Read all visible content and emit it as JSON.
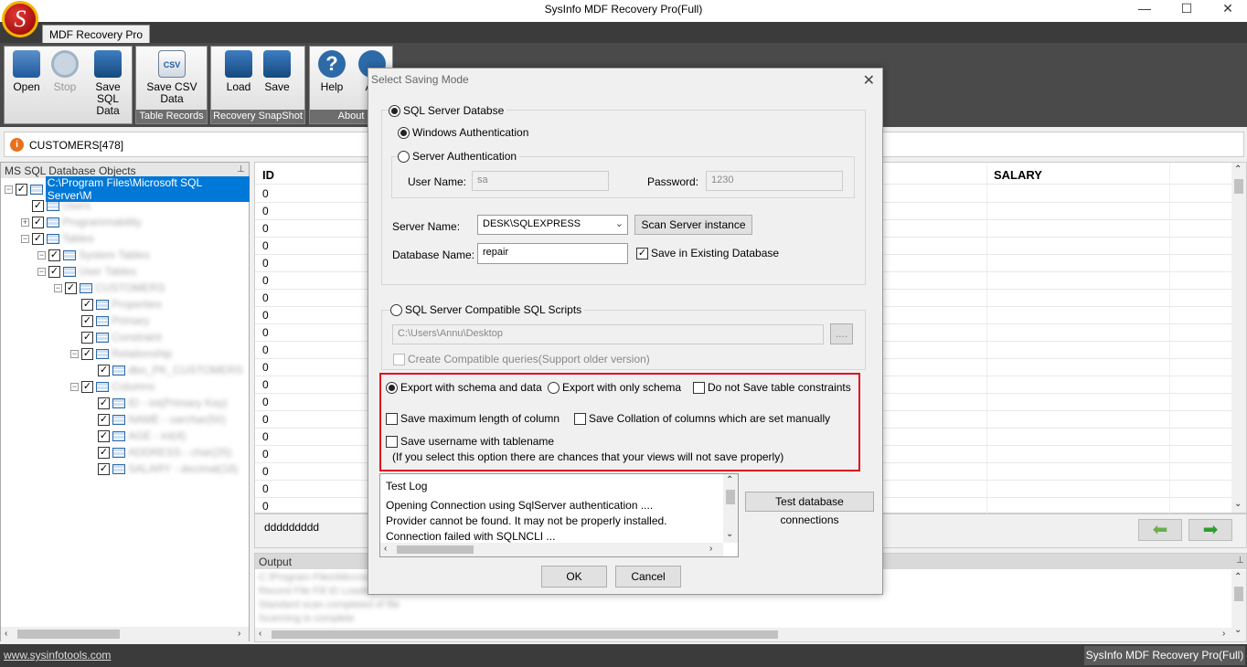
{
  "window": {
    "title": "SysInfo MDF Recovery Pro(Full)",
    "logo_letter": "S",
    "minimize_glyph": "—",
    "maximize_glyph": "☐",
    "close_glyph": "✕"
  },
  "ribbon": {
    "tab_label": "MDF Recovery Pro",
    "buttons": {
      "open": "Open",
      "stop": "Stop",
      "save_sql": "Save SQL Data",
      "save_csv": "Save CSV Data",
      "load": "Load",
      "save": "Save",
      "help": "Help",
      "about": "Ab"
    },
    "csv_icon_text": "CSV",
    "help_icon_text": "?",
    "groups": {
      "table_records": "Table Records",
      "recovery_snapshot": "Recovery SnapShot",
      "about": "About"
    }
  },
  "infobar": {
    "icon": "i",
    "text": "CUSTOMERS[478]"
  },
  "tree": {
    "header": "MS SQL Database Objects",
    "root_label": "C:\\Program Files\\Microsoft SQL Server\\M",
    "items": [
      "Users",
      "Programmability",
      "Tables",
      "System Tables",
      "User Tables",
      "CUSTOMERS",
      "Properties",
      "Primary",
      "Constraint",
      "Relationship",
      "dbo_PK_CUSTOMERS",
      "Columns",
      "ID - int(Primary Key)",
      "NAME - varchar(50)",
      "AGE - int(4)",
      "ADDRESS - char(25)",
      "SALARY - decimal(18)"
    ]
  },
  "grid": {
    "col_id": "ID",
    "col_salary": "SALARY",
    "id_values": [
      "0",
      "0",
      "0",
      "0",
      "0",
      "0",
      "0",
      "0",
      "0",
      "0",
      "0",
      "0",
      "0",
      "0",
      "0",
      "0",
      "0",
      "0",
      "0"
    ],
    "footer_text": "ddddddddd"
  },
  "output": {
    "header": "Output",
    "lines": [
      "C:\\Program Files\\Microsoft",
      "Record File Fill ID Loaded",
      "Standard scan completed of file",
      "Scanning is complete"
    ]
  },
  "statusbar": {
    "link": "www.sysinfotools.com",
    "product": "SysInfo MDF Recovery Pro(Full)"
  },
  "dialog": {
    "title": "Select Saving Mode",
    "close_glyph": "✕",
    "sql_server_db": "SQL Server Databse",
    "windows_auth": "Windows Authentication",
    "server_auth": "Server Authentication",
    "user_name_label": "User Name:",
    "user_name_value": "sa",
    "password_label": "Password:",
    "password_value": "1230",
    "server_name_label": "Server Name:",
    "server_name_value": "DESK\\SQLEXPRESS",
    "scan_button": "Scan Server instance",
    "database_name_label": "Database Name:",
    "database_name_value": "repair",
    "save_existing": "Save in Existing Database",
    "sql_scripts": "SQL Server Compatible SQL Scripts",
    "path_value": "C:\\Users\\Annu\\Desktop",
    "browse_label": "....",
    "compatible_queries": "Create Compatible queries(Support older version)",
    "export_schema_data": "Export with schema and data",
    "export_schema_only": "Export with only schema",
    "no_constraints": "Do not Save table constraints",
    "save_max_length": "Save maximum length of column",
    "save_collation": "Save Collation of columns which are set manually",
    "save_username": "Save username with tablename",
    "warning": "(If you select this option there are chances that your views will not save properly)",
    "log_title": "Test Log",
    "log_lines": [
      "Opening Connection using SqlServer authentication ....",
      "Provider cannot be found. It may not be properly installed.",
      "Connection failed with SQLNCLI ..."
    ],
    "test_button": "Test database connections",
    "ok": "OK",
    "cancel": "Cancel"
  },
  "colors": {
    "highlight_border": "#e0101c",
    "selection": "#0078d7",
    "ribbon_dark": "#4a4a4a"
  }
}
